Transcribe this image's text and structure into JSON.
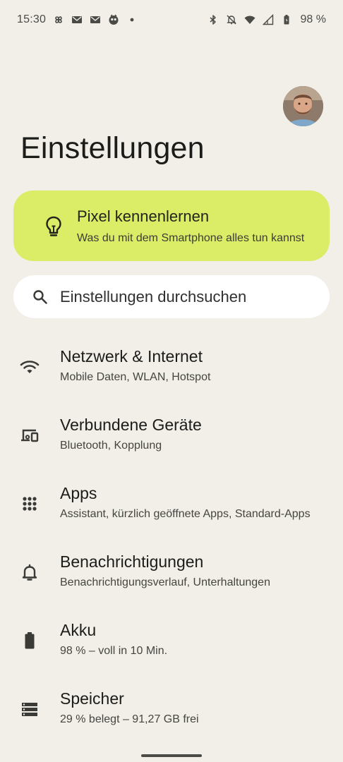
{
  "status_bar": {
    "time": "15:30",
    "battery": "98 %",
    "left_icons": [
      "pinwheel-icon",
      "mail-icon",
      "mail-icon",
      "app-icon",
      "dot-icon"
    ],
    "right_icons": [
      "bluetooth-icon",
      "bell-off-icon",
      "wifi-icon",
      "signal-icon",
      "battery-icon"
    ]
  },
  "header": {
    "title": "Einstellungen"
  },
  "pixel_card": {
    "title": "Pixel kennenlernen",
    "subtitle": "Was du mit dem Smartphone alles tun kannst",
    "icon": "lightbulb-icon",
    "color": "#dbed67"
  },
  "search": {
    "label": "Einstellungen durchsuchen",
    "icon": "search-icon"
  },
  "items": [
    {
      "title": "Netzwerk & Internet",
      "subtitle": "Mobile Daten, WLAN, Hotspot",
      "icon": "wifi-icon"
    },
    {
      "title": "Verbundene Geräte",
      "subtitle": "Bluetooth, Kopplung",
      "icon": "devices-icon"
    },
    {
      "title": "Apps",
      "subtitle": "Assistant, kürzlich geöffnete Apps, Standard-Apps",
      "icon": "apps-grid-icon"
    },
    {
      "title": "Benachrichtigungen",
      "subtitle": "Benachrichtigungsverlauf, Unterhaltungen",
      "icon": "bell-icon"
    },
    {
      "title": "Akku",
      "subtitle": "98 % – voll in 10 Min.",
      "icon": "battery-icon"
    },
    {
      "title": "Speicher",
      "subtitle": "29 % belegt – 91,27 GB frei",
      "icon": "storage-icon"
    }
  ],
  "colors": {
    "background": "#f2efe9",
    "card_accent": "#dbed67",
    "search_background": "#ffffff"
  }
}
